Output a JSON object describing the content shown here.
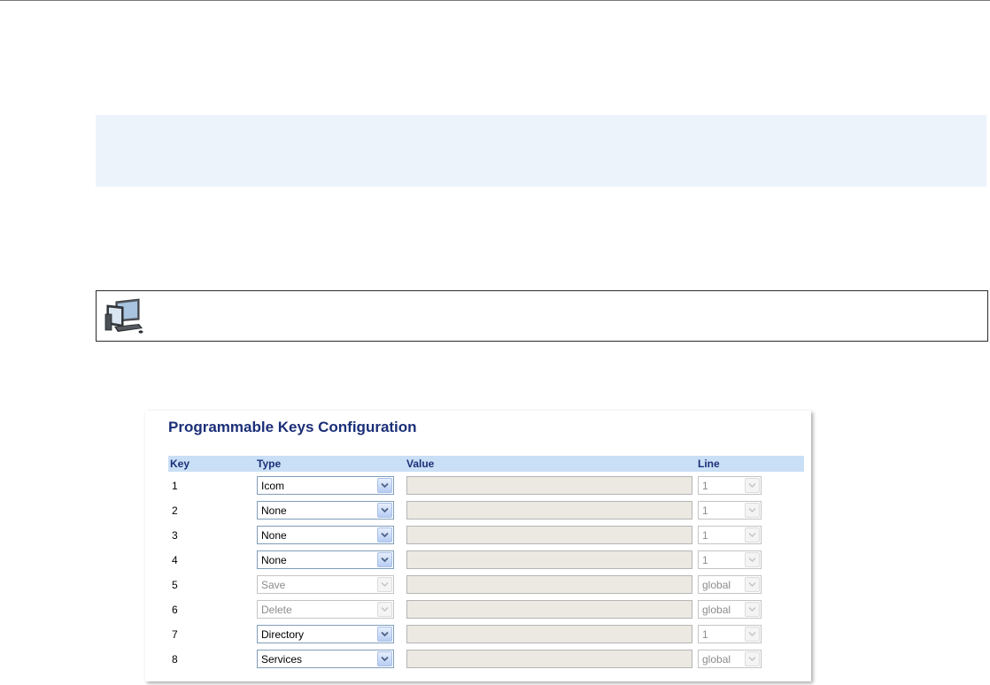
{
  "panel": {
    "title": "Programmable Keys Configuration"
  },
  "columns": {
    "key": "Key",
    "type": "Type",
    "value": "Value",
    "line": "Line"
  },
  "rows": [
    {
      "key": "1",
      "type": "Icom",
      "type_enabled": true,
      "value": "",
      "line": "1"
    },
    {
      "key": "2",
      "type": "None",
      "type_enabled": true,
      "value": "",
      "line": "1"
    },
    {
      "key": "3",
      "type": "None",
      "type_enabled": true,
      "value": "",
      "line": "1"
    },
    {
      "key": "4",
      "type": "None",
      "type_enabled": true,
      "value": "",
      "line": "1"
    },
    {
      "key": "5",
      "type": "Save",
      "type_enabled": false,
      "value": "",
      "line": "global"
    },
    {
      "key": "6",
      "type": "Delete",
      "type_enabled": false,
      "value": "",
      "line": "global"
    },
    {
      "key": "7",
      "type": "Directory",
      "type_enabled": true,
      "value": "",
      "line": "1"
    },
    {
      "key": "8",
      "type": "Services",
      "type_enabled": true,
      "value": "",
      "line": "global"
    }
  ],
  "icons": {
    "note": "computer-workstation-icon",
    "dropdown": "chevron-down-icon"
  },
  "colors": {
    "title": "#1b2f78",
    "header_bg": "#c9dff5",
    "info_box_bg": "#edf3fb",
    "value_field_bg": "#ebe9e2"
  }
}
